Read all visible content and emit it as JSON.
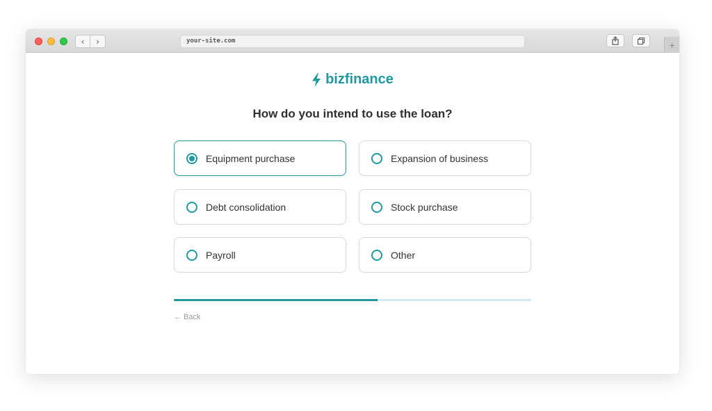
{
  "browser": {
    "url": "your-site.com",
    "new_tab_symbol": "+"
  },
  "brand": {
    "name": "bizfinance",
    "color": "#1f98a0"
  },
  "question": "How do you intend to use the loan?",
  "options": [
    {
      "label": "Equipment purchase",
      "selected": true
    },
    {
      "label": "Expansion of business",
      "selected": false
    },
    {
      "label": "Debt consolidation",
      "selected": false
    },
    {
      "label": "Stock purchase",
      "selected": false
    },
    {
      "label": "Payroll",
      "selected": false
    },
    {
      "label": "Other",
      "selected": false
    }
  ],
  "progress": {
    "fraction": 0.57
  },
  "back_label": "← Back",
  "icons": {
    "logo": "lightning-bolt-icon",
    "nav_back": "chevron-left-icon",
    "nav_forward": "chevron-right-icon",
    "share": "share-icon",
    "tabs": "tabs-icon"
  }
}
